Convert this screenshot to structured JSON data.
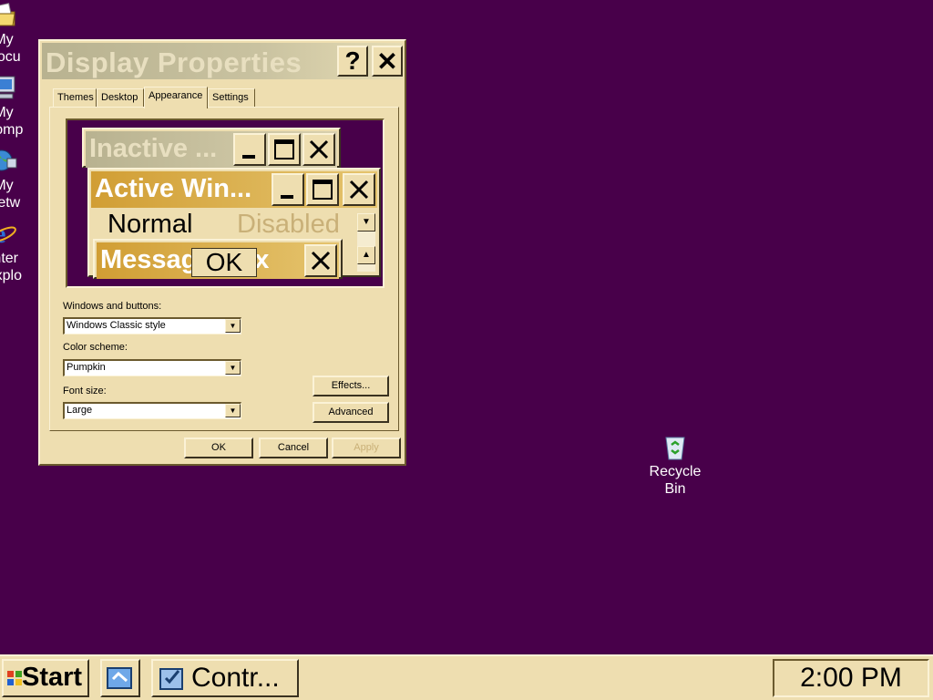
{
  "desktop": {
    "icons": [
      {
        "label_line1": "My",
        "label_line2": "Docu",
        "icon": "my-documents-icon"
      },
      {
        "label_line1": "My",
        "label_line2": "Comp",
        "icon": "my-computer-icon"
      },
      {
        "label_line1": "My",
        "label_line2": "Netw",
        "icon": "my-network-icon"
      },
      {
        "label_line1": "Inter",
        "label_line2": "Explo",
        "icon": "internet-explorer-icon"
      }
    ],
    "recycle_bin": {
      "label_line1": "Recycle",
      "label_line2": "Bin",
      "icon": "recycle-bin-icon"
    }
  },
  "dialog": {
    "title": "Display Properties",
    "help_glyph": "?",
    "close_glyph": "✕",
    "tabs": [
      "Themes",
      "Desktop",
      "Appearance",
      "Settings"
    ],
    "active_tab": "Appearance",
    "preview": {
      "inactive_title": "Inactive ...",
      "active_title": "Active Win...",
      "menu_normal": "Normal",
      "menu_disabled": "Disabled",
      "message_box_title": "Message Box",
      "ok_label": "OK"
    },
    "windows_buttons": {
      "label": "Windows and buttons:",
      "value": "Windows Classic style"
    },
    "color_scheme": {
      "label": "Color scheme:",
      "value": "Pumpkin"
    },
    "font_size": {
      "label": "Font size:",
      "value": "Large"
    },
    "effects_label": "Effects...",
    "advanced_label": "Advanced",
    "ok_label": "OK",
    "cancel_label": "Cancel",
    "apply_label": "Apply"
  },
  "taskbar": {
    "start_label": "Start",
    "task_label": "Contr...",
    "clock": "2:00 PM"
  },
  "colors": {
    "desktop": "#48004a",
    "face": "#eedeb0",
    "active_title": "#d19e34",
    "inactive_title": "#b8b290"
  }
}
